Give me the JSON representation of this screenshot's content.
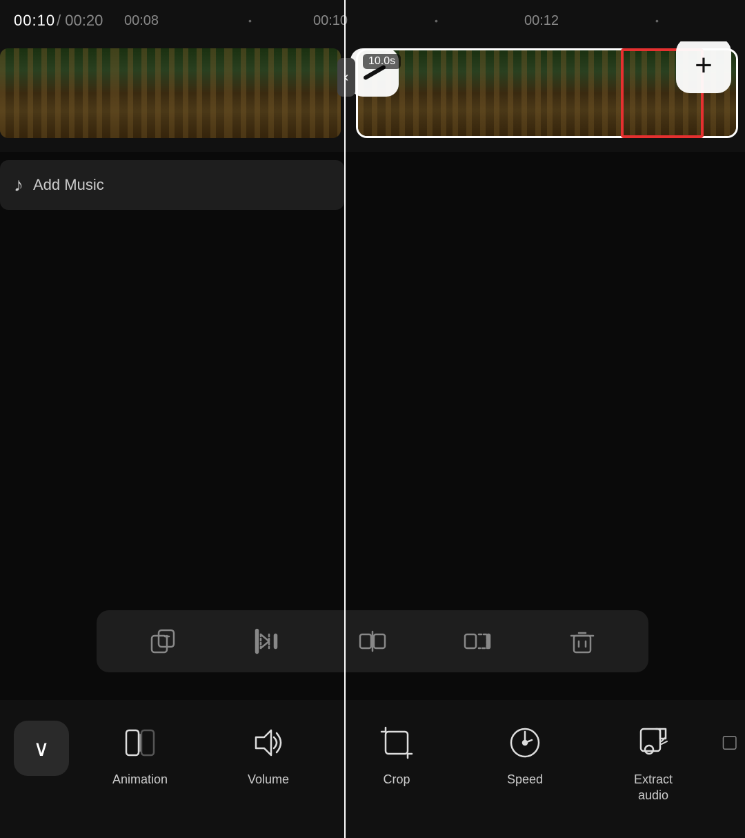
{
  "header": {
    "current_time": "00:10",
    "separator": "/",
    "total_time": "00:20",
    "marker1": "00:08",
    "marker2": "00:10",
    "marker3": "00:12"
  },
  "timeline": {
    "clip_duration": "10.0s",
    "playhead_position": "00:10"
  },
  "add_music": {
    "label": "Add Music"
  },
  "toolbar": {
    "btn1_title": "Duplicate",
    "btn2_title": "Trim Start",
    "btn3_title": "Split",
    "btn4_title": "Trim End",
    "btn5_title": "Delete"
  },
  "bottom_nav": {
    "chevron_label": "collapse",
    "items": [
      {
        "label": "Animation",
        "icon": "animation-icon"
      },
      {
        "label": "Volume",
        "icon": "volume-icon"
      },
      {
        "label": "Crop",
        "icon": "crop-icon"
      },
      {
        "label": "Speed",
        "icon": "speed-icon"
      },
      {
        "label": "Extract\naudio",
        "icon": "extract-audio-icon"
      }
    ]
  }
}
